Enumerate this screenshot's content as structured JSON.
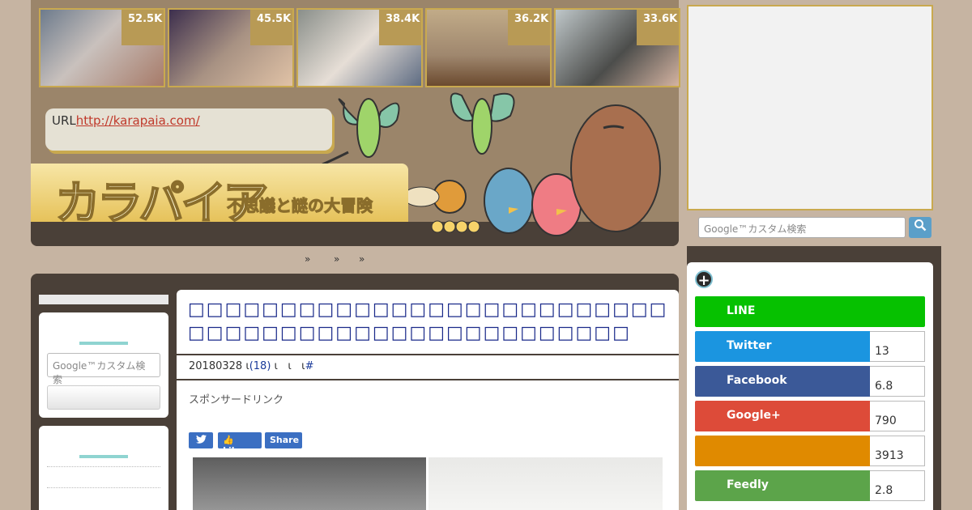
{
  "thumbnails": [
    {
      "count": "52.5K",
      "bg": "linear-gradient(135deg,#6d7b8c,#c9c1bd 45%,#a77b69)"
    },
    {
      "count": "45.5K",
      "bg": "linear-gradient(135deg,#3d2f4d,#a89283 50%,#e0c2a6)"
    },
    {
      "count": "38.4K",
      "bg": "linear-gradient(135deg,#8a8f8a,#e6ded6 50%,#5e6c83)"
    },
    {
      "count": "36.2K",
      "bg": "linear-gradient(180deg,#c1ab88,#9f876e 60%,#6b4a2f)"
    },
    {
      "count": "33.6K",
      "bg": "linear-gradient(135deg,#bfc7c9,#4c4d4b 55%,#d4b3a1)"
    }
  ],
  "header": {
    "url_label": "URL",
    "url": "http://karapaia.com/",
    "logo": "カラパイア",
    "tagline": "不思議と謎の大冒険"
  },
  "nav": {
    "items": [
      "»",
      "»",
      "»"
    ]
  },
  "sidebar_left": {
    "search_placeholder": "Google™カスタム検索"
  },
  "article": {
    "title": "□□□□□□□□□□□□□□□□□□□□□□□□□□□□□□□□□□□□□□□□□□□□□□□□□□",
    "date": "20180328",
    "sep1": "ι",
    "comments": "(18)",
    "sep2": "ι",
    "sep3": "ι",
    "sep4": "ι",
    "hash": "#",
    "sponsor": "スポンサードリンク",
    "tweet_icon": "twitter-icon",
    "like_label": "Like",
    "share_label": "Share"
  },
  "sidebar_right": {
    "search_placeholder": "Google™カスタム検索",
    "plus_symbol": "+",
    "share_rows": [
      {
        "label": "LINE",
        "count": "",
        "color": "#06c100"
      },
      {
        "label": "Twitter",
        "count": "13",
        "color": "#1b95e0"
      },
      {
        "label": "Facebook",
        "count": "6.8",
        "color": "#3b5998"
      },
      {
        "label": "Google+",
        "count": "790",
        "color": "#dd4b39"
      },
      {
        "label": "",
        "count": "3913",
        "color": "#e08a00"
      },
      {
        "label": "Feedly",
        "count": "2.8",
        "color": "#5ca44a"
      }
    ]
  }
}
